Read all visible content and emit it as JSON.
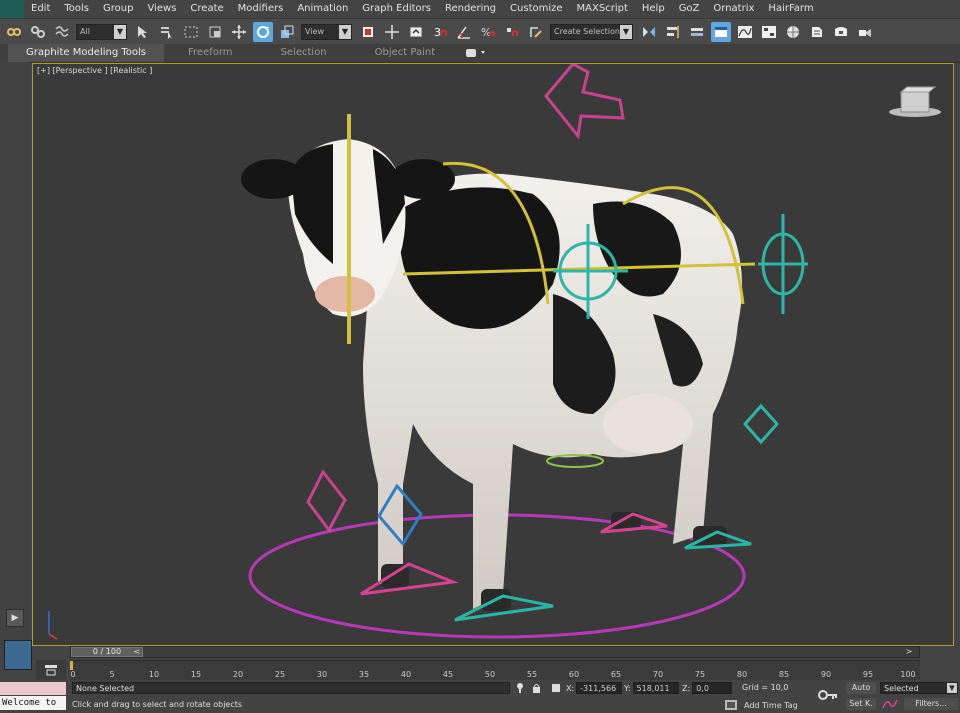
{
  "menubar": {
    "items": [
      "Edit",
      "Tools",
      "Group",
      "Views",
      "Create",
      "Modifiers",
      "Animation",
      "Graph Editors",
      "Rendering",
      "Customize",
      "MAXScript",
      "Help",
      "GoZ",
      "Ornatrix",
      "HairFarm"
    ]
  },
  "toolbar": {
    "filter_value": "All",
    "ref_coord_value": "View",
    "named_selection_placeholder": "Create Selection S",
    "snap_label": "3",
    "active_color": "#5ea7e0"
  },
  "ribbon": {
    "tabs": [
      "Graphite Modeling Tools",
      "Freeform",
      "Selection",
      "Object Paint"
    ]
  },
  "viewport": {
    "label": "[+] [Perspective ] [Realistic ]",
    "border_color": "#b49c2a",
    "background": "#3a3a3a"
  },
  "timeline": {
    "slider_label": "0 / 100",
    "prev": "<",
    "next": ">",
    "ticks": [
      "0",
      "5",
      "10",
      "15",
      "20",
      "25",
      "30",
      "35",
      "40",
      "45",
      "50",
      "55",
      "60",
      "65",
      "70",
      "75",
      "80",
      "85",
      "90",
      "95",
      "100"
    ]
  },
  "status": {
    "selection": "None Selected",
    "prompt": "Click and drag to select and rotate objects",
    "x_label": "X:",
    "x_value": "-311,566",
    "y_label": "Y:",
    "y_value": "518,011",
    "z_label": "Z:",
    "z_value": "0,0",
    "grid": "Grid = 10,0",
    "add_time_tag": "Add Time Tag",
    "auto_key": "Auto",
    "set_key": "Set K.",
    "key_filter_value": "Selected",
    "filters": "Filters...",
    "listener_text": "Welcome to"
  },
  "controls": {
    "play": "▶"
  }
}
